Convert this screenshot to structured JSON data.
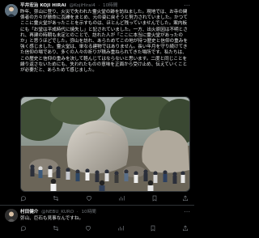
{
  "post1": {
    "author_name": "平井宏治 KOJI HIRAI",
    "author_handle": "@KojiHirai4",
    "time": "10時間",
    "body": "昨年、弥山に登り、火災で失われた霊火堂の跡を訪ねました。現地では、お寺の関係者の方々が懸命に瓦礫をまとめ、元の姿に戻そうと努力されていました。かつてここに霊火堂があったことを示すものは、ほとんど残っていませんでした。案内板にも「お堂は平成時代に焼失し」と記されていました。一方、出火原因は不明とされ、再建の時期も未定とのことで、訪れた人が「ここに本当に霊火堂があったのか」と思うほどでした。弥山を訪れ、あらためてこの地が持つ歴史と信仰の重みを強く感じました。霊火堂は、単なる建物ではありません。長い年月を守り続けてきた信仰の場であり、多くの人々の祈りが積み重ねられてきた場所です。私たちは、この歴史と信仰の重みを決して軽んじてはならないと思います。二度と同じことを繰り返さないためにも、失われたものの意味を正面から受け止め、伝えていくことが必要だと、あらためて感じました。",
    "actions": {
      "reply_count": "",
      "repost_count": "",
      "like_count": "",
      "views_count": ""
    }
  },
  "post2": {
    "author_name": "村田健介",
    "author_handle": "@NEBU_KURO",
    "time": "10時間",
    "body": "弥山、巨石も見事なんですね。"
  },
  "colors": {
    "background": "#000000",
    "text_primary": "#e7e9ea",
    "text_secondary": "#71767b",
    "divider": "#2f3336"
  },
  "icons": [
    "reply-icon",
    "repost-icon",
    "like-icon",
    "views-icon",
    "bookmark-icon",
    "share-icon",
    "more-icon"
  ]
}
